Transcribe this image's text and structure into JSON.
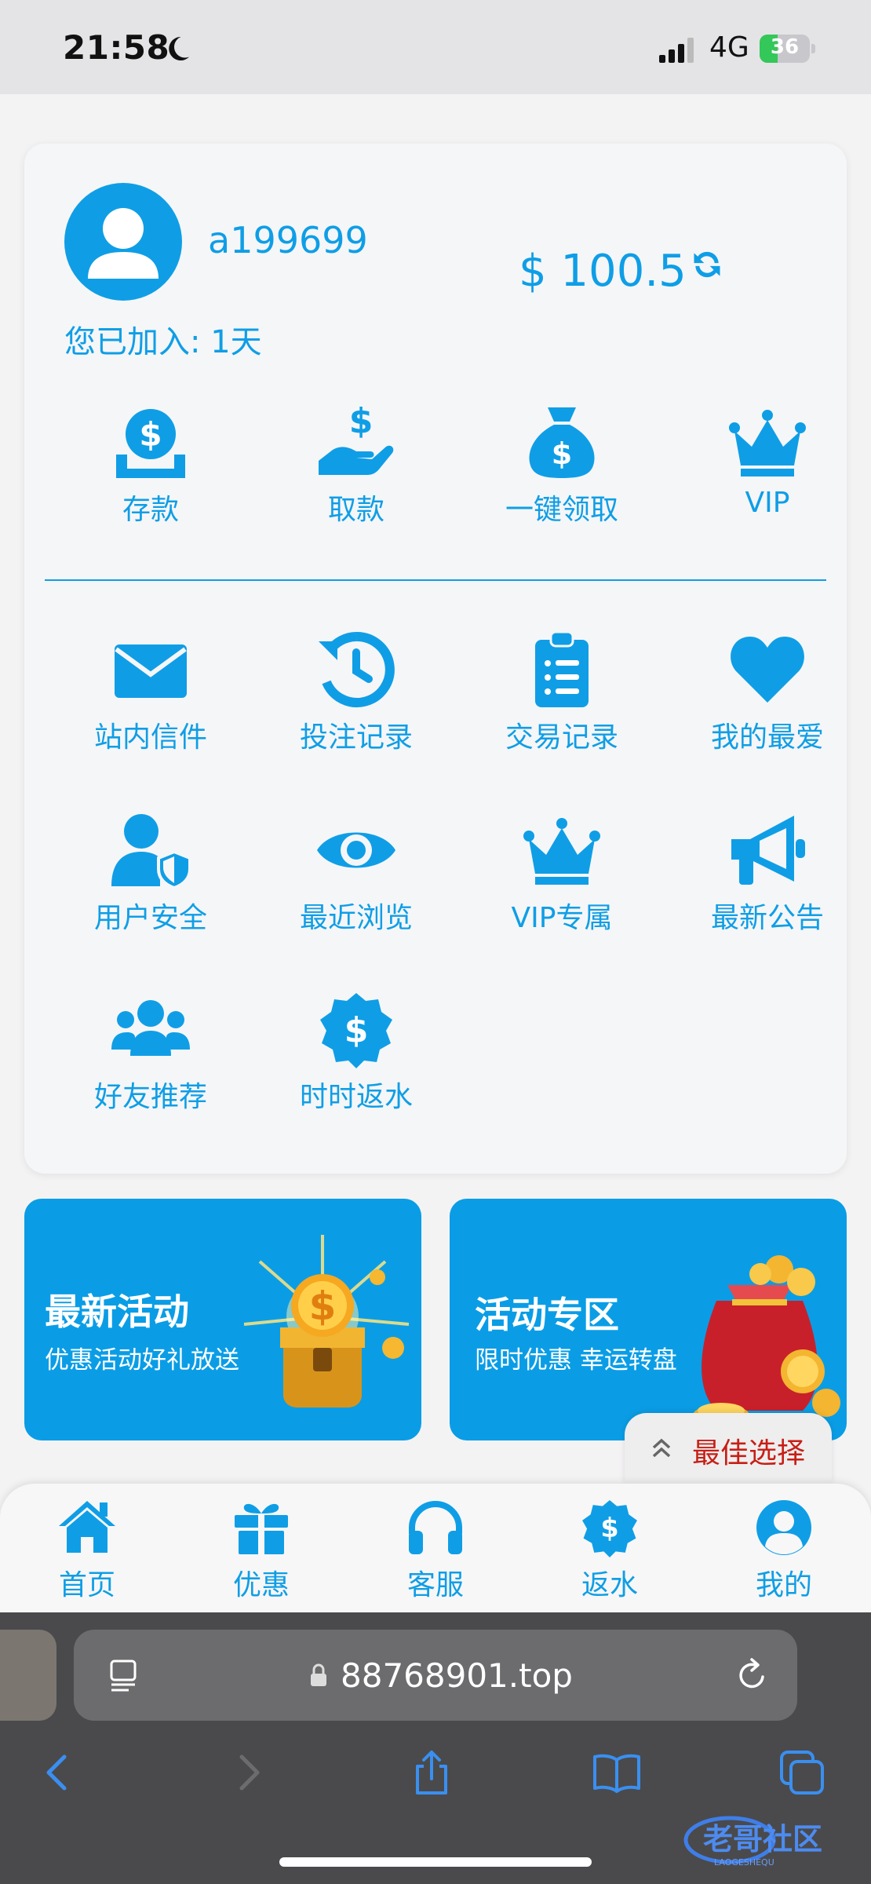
{
  "status_bar": {
    "time": "21:58",
    "network": "4G",
    "battery": "36",
    "battery_level": 0.36
  },
  "profile": {
    "username": "a199699",
    "joined": "您已加入: 1天",
    "balance": "$ 100.5"
  },
  "quick_actions": [
    {
      "label": "存款",
      "icon": "deposit-coin-icon"
    },
    {
      "label": "取款",
      "icon": "withdraw-hand-icon"
    },
    {
      "label": "一键领取",
      "icon": "money-bag-icon"
    },
    {
      "label": "VIP",
      "icon": "crown-icon"
    }
  ],
  "menu_items": [
    {
      "label": "站内信件",
      "icon": "mail-icon"
    },
    {
      "label": "投注记录",
      "icon": "history-icon"
    },
    {
      "label": "交易记录",
      "icon": "clipboard-list-icon"
    },
    {
      "label": "我的最爱",
      "icon": "heart-icon"
    },
    {
      "label": "用户安全",
      "icon": "user-shield-icon"
    },
    {
      "label": "最近浏览",
      "icon": "eye-icon"
    },
    {
      "label": "VIP专属",
      "icon": "crown-icon"
    },
    {
      "label": "最新公告",
      "icon": "megaphone-icon"
    },
    {
      "label": "好友推荐",
      "icon": "users-icon"
    },
    {
      "label": "时时返水",
      "icon": "dollar-badge-icon"
    }
  ],
  "banners": [
    {
      "title": "最新活动",
      "subtitle": "优惠活动好礼放送",
      "icon": "treasure-chest-icon"
    },
    {
      "title": "活动专区",
      "subtitle": "限时优惠 幸运转盘",
      "icon": "coin-bag-icon"
    }
  ],
  "best_choice": {
    "label": "最佳选择"
  },
  "bottom_nav": [
    {
      "label": "首页",
      "icon": "home-icon"
    },
    {
      "label": "优惠",
      "icon": "gift-icon"
    },
    {
      "label": "客服",
      "icon": "headphones-icon"
    },
    {
      "label": "返水",
      "icon": "dollar-badge-icon"
    },
    {
      "label": "我的",
      "icon": "user-circle-icon"
    }
  ],
  "browser": {
    "url": "88768901.top"
  },
  "watermark": {
    "text": "老哥社区",
    "subtext": "LAOGESHEQU"
  },
  "colors": {
    "accent": "#0f9ee6",
    "banner": "#0a9de6",
    "best_text": "#c71f16"
  }
}
